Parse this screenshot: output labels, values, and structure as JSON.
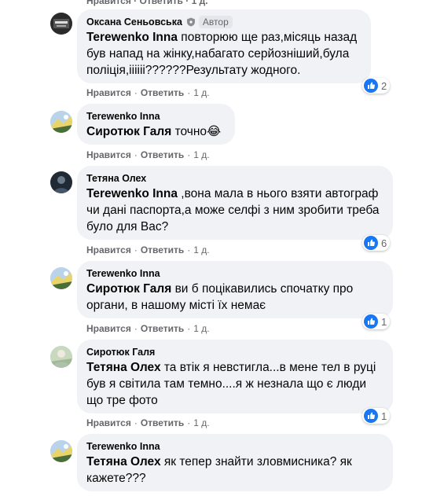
{
  "top_partial": "Нравится · Ответить · 1 д.",
  "comments": [
    {
      "author": "Оксана Сеньовська",
      "role_badge": "Автор",
      "mention": "Terewenko Inna",
      "text": " повторюю ще раз,місяць назад був напад на жінку,набагато серйозніший,була поліція,іііііі??????Результату жодного.",
      "like_label": "Нравится",
      "reply_label": "Ответить",
      "time": "1 д.",
      "reactions": "2"
    },
    {
      "author": "Terewenko Inna",
      "mention": "Сиротюк Галя",
      "text": " точно",
      "emoji": "😂",
      "like_label": "Нравится",
      "reply_label": "Ответить",
      "time": "1 д."
    },
    {
      "author": "Тетяна Олех",
      "mention": "Terewenko Inna",
      "text": " ,вона мала в нього взяти автограф чи дані паспорта,а може селфі з ним зробити треба було для Вас?",
      "like_label": "Нравится",
      "reply_label": "Ответить",
      "time": "1 д.",
      "reactions": "6"
    },
    {
      "author": "Terewenko Inna",
      "mention": "Сиротюк Галя",
      "text": " ви б поцікавились спочатку про органи, в нашому місті їх немає",
      "like_label": "Нравится",
      "reply_label": "Ответить",
      "time": "1 д.",
      "reactions": "1"
    },
    {
      "author": "Сиротюк Галя",
      "mention": "Тетяна Олех",
      "text": " та втік я невстигла...в мене тел в руці був я світила там темно....я ж незнала що є люди що тре фото",
      "like_label": "Нравится",
      "reply_label": "Ответить",
      "time": "1 д.",
      "reactions": "1"
    },
    {
      "author": "Terewenko Inna",
      "mention": "Тетяна Олех",
      "text": " як тепер знайти зловмисника? як кажете???"
    }
  ],
  "colors": {
    "bubble_bg": "#f0f2f5",
    "secondary_text": "#65676b",
    "like_blue": "#1877f2"
  }
}
